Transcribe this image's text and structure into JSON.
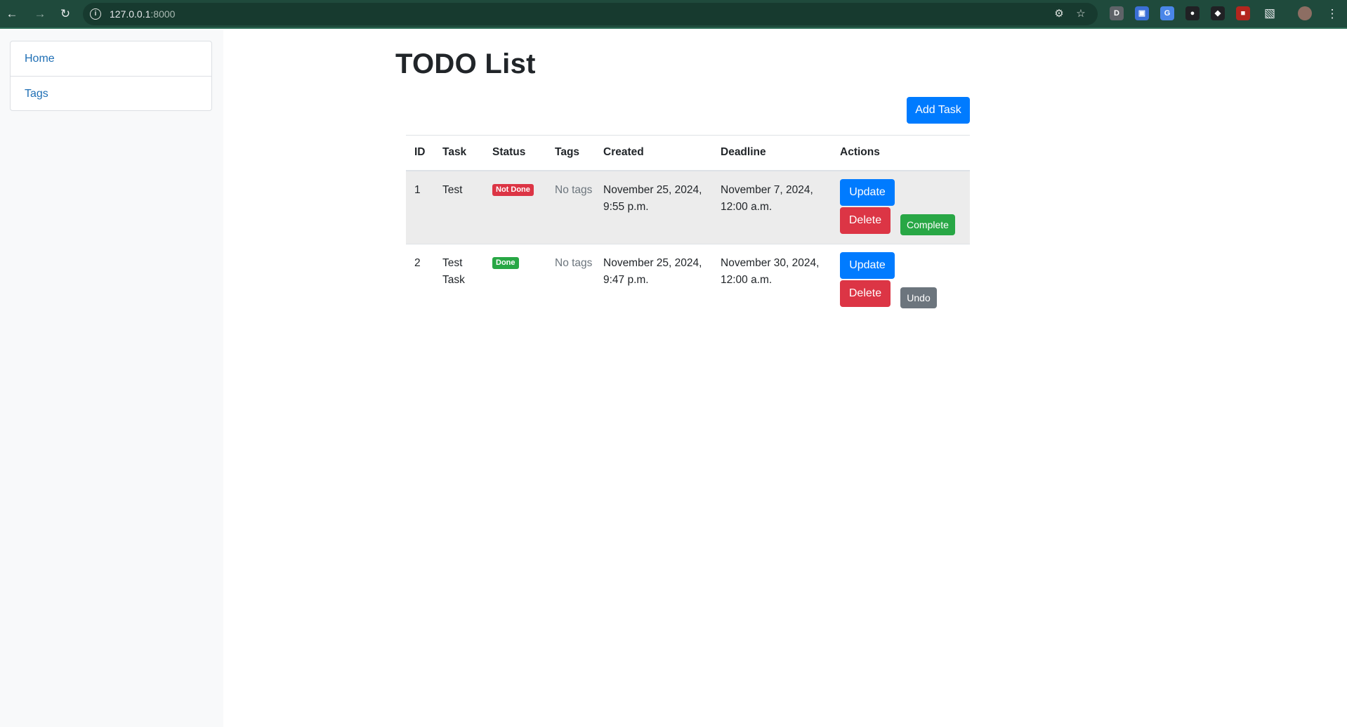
{
  "browser": {
    "url_host": "127.0.0.1",
    "url_port": ":8000"
  },
  "sidebar": {
    "items": [
      {
        "label": "Home"
      },
      {
        "label": "Tags"
      }
    ]
  },
  "main": {
    "title": "TODO List",
    "add_button": "Add Task",
    "table": {
      "headers": [
        "ID",
        "Task",
        "Status",
        "Tags",
        "Created",
        "Deadline",
        "Actions"
      ],
      "rows": [
        {
          "id": "1",
          "task": "Test",
          "status": "Not Done",
          "tags": "No tags",
          "created": "November 25, 2024, 9:55 p.m.",
          "deadline": "November 7, 2024, 12:00 a.m.",
          "update": "Update",
          "delete": "Delete",
          "toggle": "Complete"
        },
        {
          "id": "2",
          "task": "Test Task",
          "status": "Done",
          "tags": "No tags",
          "created": "November 25, 2024, 9:47 p.m.",
          "deadline": "November 30, 2024, 12:00 a.m.",
          "update": "Update",
          "delete": "Delete",
          "toggle": "Undo"
        }
      ]
    }
  },
  "colors": {
    "primary": "#007bff",
    "danger": "#dc3545",
    "success": "#28a745",
    "secondary": "#6c757d",
    "browser_bar": "#1f4a3c"
  },
  "icons": [
    "back-arrow-icon",
    "forward-arrow-icon",
    "reload-icon",
    "site-info-icon",
    "translate-icon",
    "bookmark-star-icon",
    "extensions-puzzle-icon",
    "profile-avatar-icon",
    "menu-kebab-icon"
  ]
}
